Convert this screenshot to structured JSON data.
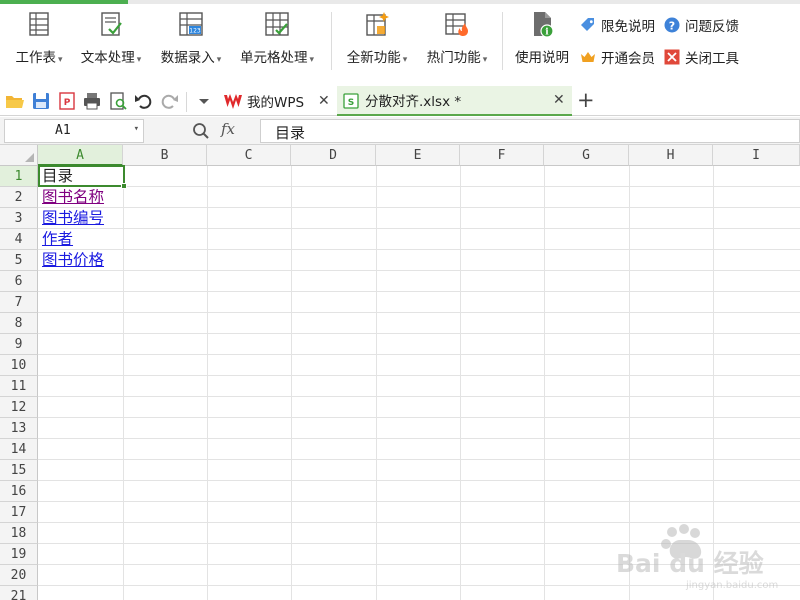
{
  "ribbon": {
    "groups": [
      {
        "label": "工作表",
        "icon": "worksheet-icon"
      },
      {
        "label": "文本处理",
        "icon": "text-process-icon"
      },
      {
        "label": "数据录入",
        "icon": "data-entry-icon"
      },
      {
        "label": "单元格处理",
        "icon": "cell-process-icon"
      },
      {
        "label": "全新功能",
        "icon": "new-feature-icon"
      },
      {
        "label": "热门功能",
        "icon": "hot-feature-icon"
      },
      {
        "label": "使用说明",
        "icon": "usage-guide-icon"
      }
    ],
    "small_items": {
      "free_info": "限免说明",
      "feedback": "问题反馈",
      "membership": "开通会员",
      "close_tool": "关闭工具"
    }
  },
  "tabs": [
    {
      "label": "我的WPS",
      "active": false
    },
    {
      "label": "分散对齐.xlsx *",
      "active": true
    }
  ],
  "formula_bar": {
    "name_box": "A1",
    "fx_label": "fx",
    "content": "目录"
  },
  "sheet": {
    "columns": [
      "A",
      "B",
      "C",
      "D",
      "E",
      "F",
      "G",
      "H",
      "I"
    ],
    "rows": [
      "1",
      "2",
      "3",
      "4",
      "5",
      "6",
      "7",
      "8",
      "9",
      "10",
      "11",
      "12",
      "13",
      "14",
      "15",
      "16",
      "17",
      "18",
      "19",
      "20",
      "21"
    ],
    "active_cell": "A1",
    "cells": {
      "a1": "目录",
      "a2": "图书名称",
      "a3": "图书编号",
      "a4": "作者",
      "a5": "图书价格"
    }
  },
  "watermark": {
    "brand": "Bai du 经验",
    "url": "jingyan.baidu.com"
  },
  "colors": {
    "accent": "#3c8a2e",
    "link": "#1a1ae0",
    "visited_link": "#800080",
    "wps_red": "#e0292b"
  }
}
